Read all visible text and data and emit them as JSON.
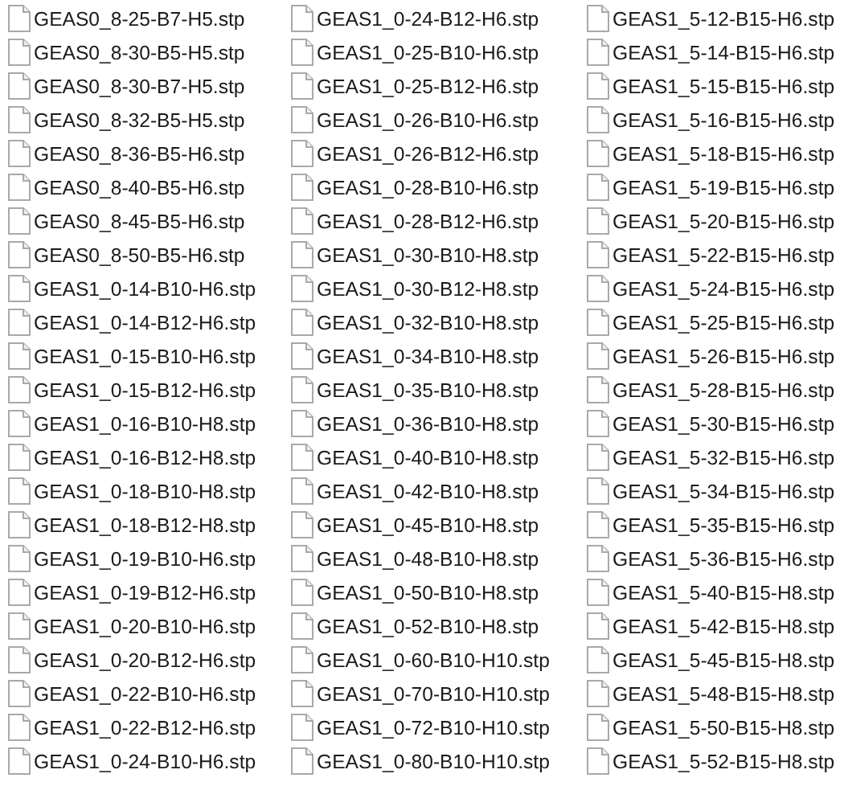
{
  "files": [
    {
      "name": "GEAS0_8-25-B7-H5.stp"
    },
    {
      "name": "GEAS0_8-30-B5-H5.stp"
    },
    {
      "name": "GEAS0_8-30-B7-H5.stp"
    },
    {
      "name": "GEAS0_8-32-B5-H5.stp"
    },
    {
      "name": "GEAS0_8-36-B5-H6.stp"
    },
    {
      "name": "GEAS0_8-40-B5-H6.stp"
    },
    {
      "name": "GEAS0_8-45-B5-H6.stp"
    },
    {
      "name": "GEAS0_8-50-B5-H6.stp"
    },
    {
      "name": "GEAS1_0-14-B10-H6.stp"
    },
    {
      "name": "GEAS1_0-14-B12-H6.stp"
    },
    {
      "name": "GEAS1_0-15-B10-H6.stp"
    },
    {
      "name": "GEAS1_0-15-B12-H6.stp"
    },
    {
      "name": "GEAS1_0-16-B10-H8.stp"
    },
    {
      "name": "GEAS1_0-16-B12-H8.stp"
    },
    {
      "name": "GEAS1_0-18-B10-H8.stp"
    },
    {
      "name": "GEAS1_0-18-B12-H8.stp"
    },
    {
      "name": "GEAS1_0-19-B10-H6.stp"
    },
    {
      "name": "GEAS1_0-19-B12-H6.stp"
    },
    {
      "name": "GEAS1_0-20-B10-H6.stp"
    },
    {
      "name": "GEAS1_0-20-B12-H6.stp"
    },
    {
      "name": "GEAS1_0-22-B10-H6.stp"
    },
    {
      "name": "GEAS1_0-22-B12-H6.stp"
    },
    {
      "name": "GEAS1_0-24-B10-H6.stp"
    },
    {
      "name": "GEAS1_0-24-B12-H6.stp"
    },
    {
      "name": "GEAS1_0-25-B10-H6.stp"
    },
    {
      "name": "GEAS1_0-25-B12-H6.stp"
    },
    {
      "name": "GEAS1_0-26-B10-H6.stp"
    },
    {
      "name": "GEAS1_0-26-B12-H6.stp"
    },
    {
      "name": "GEAS1_0-28-B10-H6.stp"
    },
    {
      "name": "GEAS1_0-28-B12-H6.stp"
    },
    {
      "name": "GEAS1_0-30-B10-H8.stp"
    },
    {
      "name": "GEAS1_0-30-B12-H8.stp"
    },
    {
      "name": "GEAS1_0-32-B10-H8.stp"
    },
    {
      "name": "GEAS1_0-34-B10-H8.stp"
    },
    {
      "name": "GEAS1_0-35-B10-H8.stp"
    },
    {
      "name": "GEAS1_0-36-B10-H8.stp"
    },
    {
      "name": "GEAS1_0-40-B10-H8.stp"
    },
    {
      "name": "GEAS1_0-42-B10-H8.stp"
    },
    {
      "name": "GEAS1_0-45-B10-H8.stp"
    },
    {
      "name": "GEAS1_0-48-B10-H8.stp"
    },
    {
      "name": "GEAS1_0-50-B10-H8.stp"
    },
    {
      "name": "GEAS1_0-52-B10-H8.stp"
    },
    {
      "name": "GEAS1_0-60-B10-H10.stp"
    },
    {
      "name": "GEAS1_0-70-B10-H10.stp"
    },
    {
      "name": "GEAS1_0-72-B10-H10.stp"
    },
    {
      "name": "GEAS1_0-80-B10-H10.stp"
    },
    {
      "name": "GEAS1_5-12-B15-H6.stp"
    },
    {
      "name": "GEAS1_5-14-B15-H6.stp"
    },
    {
      "name": "GEAS1_5-15-B15-H6.stp"
    },
    {
      "name": "GEAS1_5-16-B15-H6.stp"
    },
    {
      "name": "GEAS1_5-18-B15-H6.stp"
    },
    {
      "name": "GEAS1_5-19-B15-H6.stp"
    },
    {
      "name": "GEAS1_5-20-B15-H6.stp"
    },
    {
      "name": "GEAS1_5-22-B15-H6.stp"
    },
    {
      "name": "GEAS1_5-24-B15-H6.stp"
    },
    {
      "name": "GEAS1_5-25-B15-H6.stp"
    },
    {
      "name": "GEAS1_5-26-B15-H6.stp"
    },
    {
      "name": "GEAS1_5-28-B15-H6.stp"
    },
    {
      "name": "GEAS1_5-30-B15-H6.stp"
    },
    {
      "name": "GEAS1_5-32-B15-H6.stp"
    },
    {
      "name": "GEAS1_5-34-B15-H6.stp"
    },
    {
      "name": "GEAS1_5-35-B15-H6.stp"
    },
    {
      "name": "GEAS1_5-36-B15-H6.stp"
    },
    {
      "name": "GEAS1_5-40-B15-H8.stp"
    },
    {
      "name": "GEAS1_5-42-B15-H8.stp"
    },
    {
      "name": "GEAS1_5-45-B15-H8.stp"
    },
    {
      "name": "GEAS1_5-48-B15-H8.stp"
    },
    {
      "name": "GEAS1_5-50-B15-H8.stp"
    },
    {
      "name": "GEAS1_5-52-B15-H8.stp"
    }
  ]
}
